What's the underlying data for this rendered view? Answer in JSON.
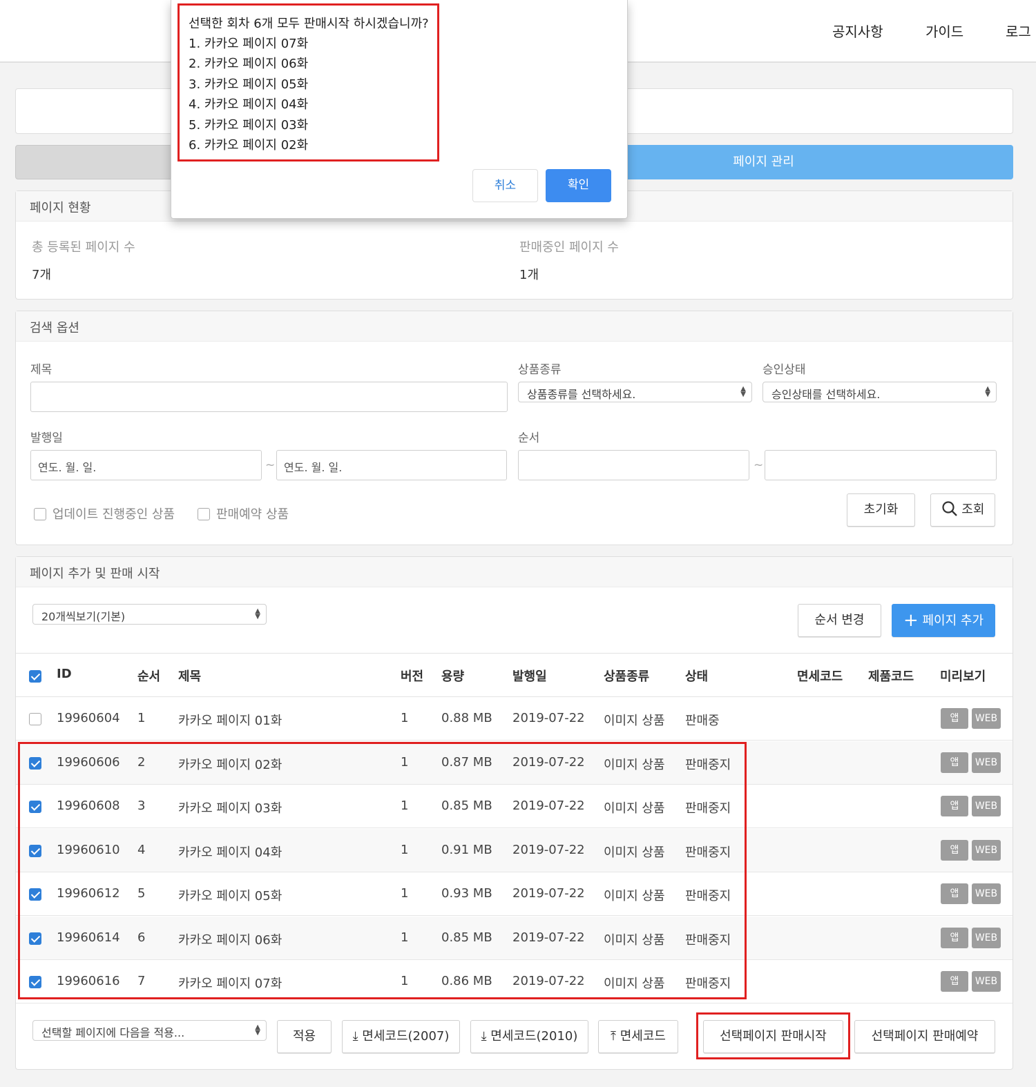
{
  "header": {
    "nav": [
      "공지사항",
      "가이드",
      "로그"
    ]
  },
  "tabs": {
    "right_label": "페이지 관리"
  },
  "status_panel": {
    "title": "페이지 현황",
    "total_label": "총 등록된 페이지 수",
    "total_value": "7개",
    "selling_label": "판매중인 페이지 수",
    "selling_value": "1개"
  },
  "search": {
    "title": "검색 옵션",
    "title_label": "제목",
    "product_type_label": "상품종류",
    "product_type_placeholder": "상품종류를 선택하세요.",
    "approval_label": "승인상태",
    "approval_placeholder": "승인상태를 선택하세요.",
    "date_label": "발행일",
    "date_placeholder": "연도. 월. 일.",
    "order_label": "순서",
    "tilde": "~",
    "check_update": "업데이트 진행중인 상품",
    "check_reserve": "판매예약 상품",
    "reset_label": "초기화",
    "search_label": "조회"
  },
  "list": {
    "title": "페이지 추가 및 판매 시작",
    "page_size": "20개씩보기(기본)",
    "reorder_label": "순서 변경",
    "add_label": "페이지 추가",
    "columns": [
      "ID",
      "순서",
      "제목",
      "버전",
      "용량",
      "발행일",
      "상품종류",
      "상태",
      "면세코드",
      "제품코드",
      "미리보기"
    ],
    "rows": [
      {
        "id": "19960604",
        "order": "1",
        "title": "카카오 페이지 01화",
        "version": "1",
        "size": "0.88 MB",
        "date": "2019-07-22",
        "type": "이미지 상품",
        "status": "판매중",
        "checked": false
      },
      {
        "id": "19960606",
        "order": "2",
        "title": "카카오 페이지 02화",
        "version": "1",
        "size": "0.87 MB",
        "date": "2019-07-22",
        "type": "이미지 상품",
        "status": "판매중지",
        "checked": true
      },
      {
        "id": "19960608",
        "order": "3",
        "title": "카카오 페이지 03화",
        "version": "1",
        "size": "0.85 MB",
        "date": "2019-07-22",
        "type": "이미지 상품",
        "status": "판매중지",
        "checked": true
      },
      {
        "id": "19960610",
        "order": "4",
        "title": "카카오 페이지 04화",
        "version": "1",
        "size": "0.91 MB",
        "date": "2019-07-22",
        "type": "이미지 상품",
        "status": "판매중지",
        "checked": true
      },
      {
        "id": "19960612",
        "order": "5",
        "title": "카카오 페이지 05화",
        "version": "1",
        "size": "0.93 MB",
        "date": "2019-07-22",
        "type": "이미지 상품",
        "status": "판매중지",
        "checked": true
      },
      {
        "id": "19960614",
        "order": "6",
        "title": "카카오 페이지 06화",
        "version": "1",
        "size": "0.85 MB",
        "date": "2019-07-22",
        "type": "이미지 상품",
        "status": "판매중지",
        "checked": true
      },
      {
        "id": "19960616",
        "order": "7",
        "title": "카카오 페이지 07화",
        "version": "1",
        "size": "0.86 MB",
        "date": "2019-07-22",
        "type": "이미지 상품",
        "status": "판매중지",
        "checked": true
      }
    ],
    "preview_app": "앱",
    "preview_web": "WEB"
  },
  "footer": {
    "bulk_select": "선택할 페이지에 다음을 적용...",
    "apply": "적용",
    "dl_2007": "면세코드(2007)",
    "dl_2010": "면세코드(2010)",
    "upload": "면세코드",
    "start_sale": "선택페이지 판매시작",
    "reserve_sale": "선택페이지 판매예약"
  },
  "dialog": {
    "message": "선택한 회차 6개 모두 판매시작 하시겠습니까?",
    "items": [
      "1. 카카오 페이지 07화",
      "2. 카카오 페이지 06화",
      "3. 카카오 페이지 05화",
      "4. 카카오 페이지 04화",
      "5. 카카오 페이지 03화",
      "6. 카카오 페이지 02화"
    ],
    "cancel": "취소",
    "confirm": "확인"
  },
  "colors": {
    "accent": "#3d96ee",
    "tab_active": "#66b3f0",
    "highlight": "#e02020"
  }
}
